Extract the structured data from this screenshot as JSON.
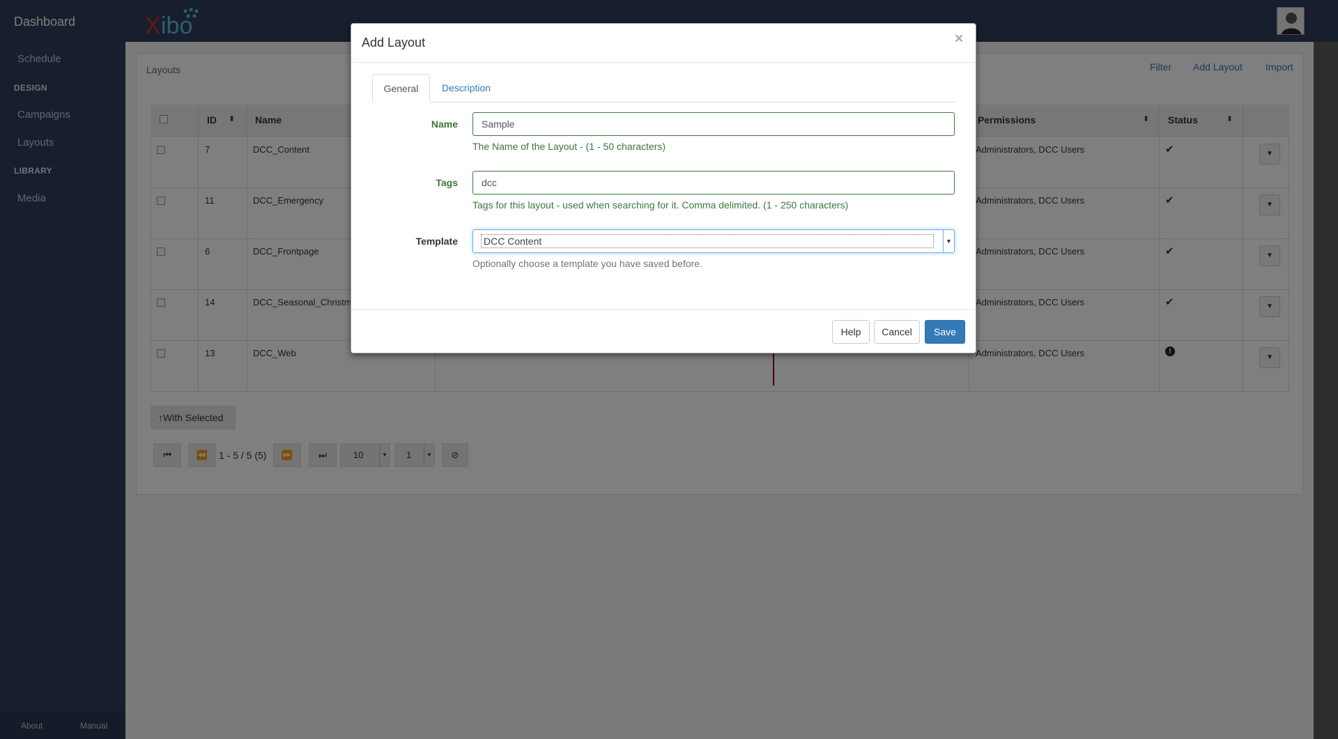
{
  "sidebar": {
    "brand": "Dashboard",
    "items": [
      {
        "label": "Schedule"
      },
      {
        "heading": "DESIGN"
      },
      {
        "label": "Campaigns"
      },
      {
        "label": "Layouts"
      },
      {
        "heading": "LIBRARY"
      },
      {
        "label": "Media"
      }
    ],
    "footer": {
      "about": "About",
      "manual": "Manual"
    }
  },
  "header": {
    "logo_text": "Xibo"
  },
  "panel": {
    "title": "Layouts",
    "links": {
      "filter": "Filter",
      "add_layout": "Add Layout",
      "import": "Import"
    }
  },
  "table": {
    "headers": {
      "id": "ID",
      "name": "Name",
      "permissions": "Permissions",
      "status": "Status"
    },
    "rows": [
      {
        "id": "7",
        "name": "DCC_Content",
        "permissions": "Administrators, DCC Users",
        "status": "✔"
      },
      {
        "id": "11",
        "name": "DCC_Emergency",
        "permissions": "Administrators, DCC Users",
        "status": "✔"
      },
      {
        "id": "6",
        "name": "DCC_Frontpage",
        "permissions": "Administrators, DCC Users",
        "status": "✔"
      },
      {
        "id": "14",
        "name": "DCC_Seasonal_Christm",
        "permissions": "Administrators, DCC Users",
        "status": "✔"
      },
      {
        "id": "13",
        "name": "DCC_Web",
        "permissions": "Administrators, DCC Users",
        "status": "!"
      }
    ]
  },
  "footer_controls": {
    "with_selected": "With Selected",
    "range_text": "1 - 5 / 5 (5)",
    "page_size": "10",
    "page_number": "1"
  },
  "modal": {
    "title": "Add Layout",
    "close": "×",
    "tabs": {
      "general": "General",
      "description": "Description"
    },
    "fields": {
      "name_label": "Name",
      "name_value": "Sample",
      "name_help": "The Name of the Layout - (1 - 50 characters)",
      "tags_label": "Tags",
      "tags_value": "dcc",
      "tags_help": "Tags for this layout - used when searching for it. Comma delimited. (1 - 250 characters)",
      "template_label": "Template",
      "template_value": "DCC Content",
      "template_help": "Optionally choose a template you have saved before."
    },
    "buttons": {
      "help": "Help",
      "cancel": "Cancel",
      "save": "Save"
    }
  },
  "colors": {
    "sidebar": "#2f3d5a",
    "primary": "#337ab7",
    "success_text": "#3c763d"
  }
}
